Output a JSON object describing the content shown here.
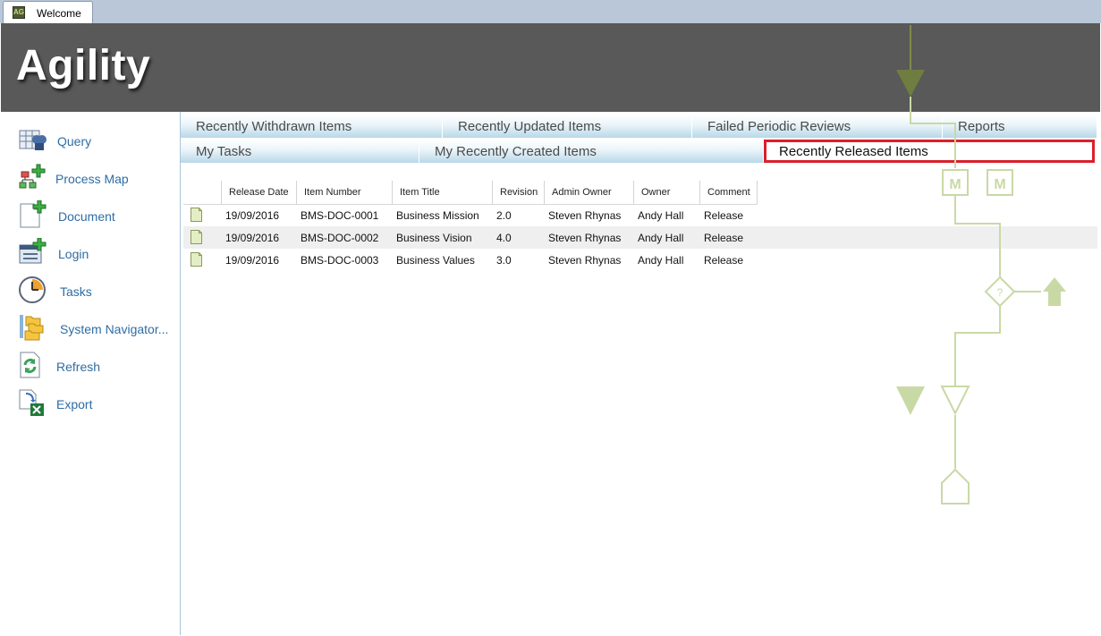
{
  "window": {
    "tab_label": "Welcome",
    "app_icon_text": "AG"
  },
  "header": {
    "title": "Agility"
  },
  "sidebar": {
    "items": [
      {
        "label": "Query",
        "icon": "query-icon"
      },
      {
        "label": "Process Map",
        "icon": "process-map-icon"
      },
      {
        "label": "Document",
        "icon": "document-add-icon"
      },
      {
        "label": "Login",
        "icon": "login-icon"
      },
      {
        "label": "Tasks",
        "icon": "clock-icon"
      },
      {
        "label": "System Navigator...",
        "icon": "folders-icon"
      },
      {
        "label": "Refresh",
        "icon": "refresh-icon"
      },
      {
        "label": "Export",
        "icon": "excel-export-icon"
      }
    ]
  },
  "tabs": {
    "row1": [
      "Recently Withdrawn Items",
      "Recently Updated Items",
      "Failed Periodic Reviews",
      "Reports"
    ],
    "row2": [
      "My Tasks",
      "My Recently Created Items",
      "Recently Released Items"
    ],
    "active": "Recently Released Items"
  },
  "grid": {
    "columns": [
      "Release Date",
      "Item Number",
      "Item Title",
      "Revision",
      "Admin Owner",
      "Owner",
      "Comment"
    ],
    "rows": [
      [
        "19/09/2016",
        "BMS-DOC-0001",
        "Business Mission",
        "2.0",
        "Steven Rhynas",
        "Andy Hall",
        "Release"
      ],
      [
        "19/09/2016",
        "BMS-DOC-0002",
        "Business Vision",
        "4.0",
        "Steven Rhynas",
        "Andy Hall",
        "Release"
      ],
      [
        "19/09/2016",
        "BMS-DOC-0003",
        "Business Values",
        "3.0",
        "Steven Rhynas",
        "Andy Hall",
        "Release"
      ]
    ]
  },
  "watermark": {
    "labels": [
      "M",
      "M",
      "?"
    ]
  },
  "colors": {
    "header_bg": "#595959",
    "link": "#2e6da4",
    "active_tab_border": "#d9202b",
    "watermark": "#c9d9a6"
  }
}
